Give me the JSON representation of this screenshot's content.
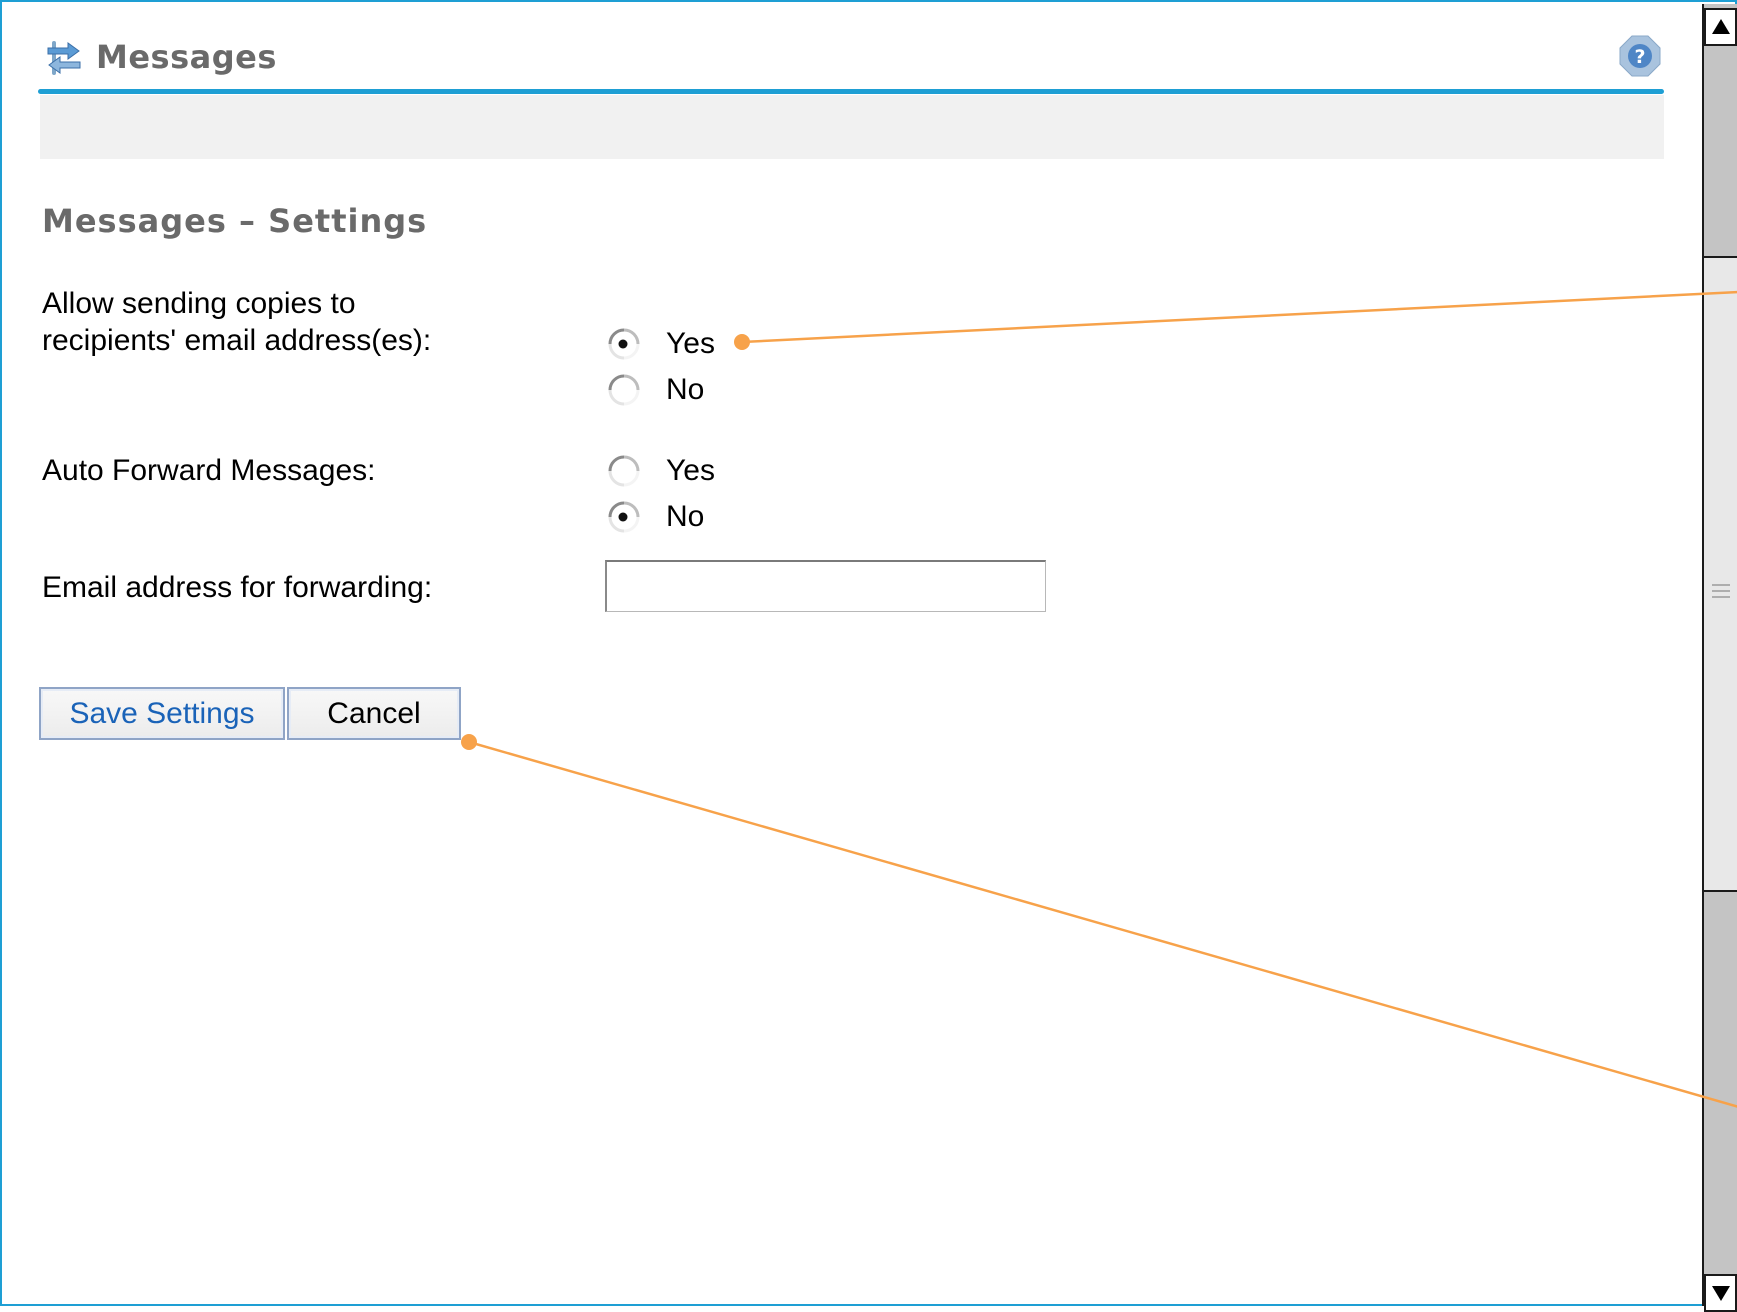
{
  "header": {
    "title": "Messages",
    "icon": "messages-arrows-icon",
    "help_icon": "help-question-icon"
  },
  "section": {
    "title": "Messages – Settings"
  },
  "form": {
    "copies_label_line1": "Allow sending copies to",
    "copies_label_line2": "recipients' email address(es):",
    "copies_options": [
      {
        "label": "Yes",
        "checked": true
      },
      {
        "label": "No",
        "checked": false
      }
    ],
    "forward_label": "Auto Forward Messages:",
    "forward_options": [
      {
        "label": "Yes",
        "checked": false
      },
      {
        "label": "No",
        "checked": true
      }
    ],
    "email_label": "Email address for forwarding:",
    "email_value": ""
  },
  "buttons": {
    "save_label": "Save Settings",
    "cancel_label": "Cancel"
  },
  "colors": {
    "accent": "#1e9fd4",
    "annotation": "#f7a24a",
    "heading": "#6a6a6a",
    "link_button_text": "#1a63b8"
  }
}
